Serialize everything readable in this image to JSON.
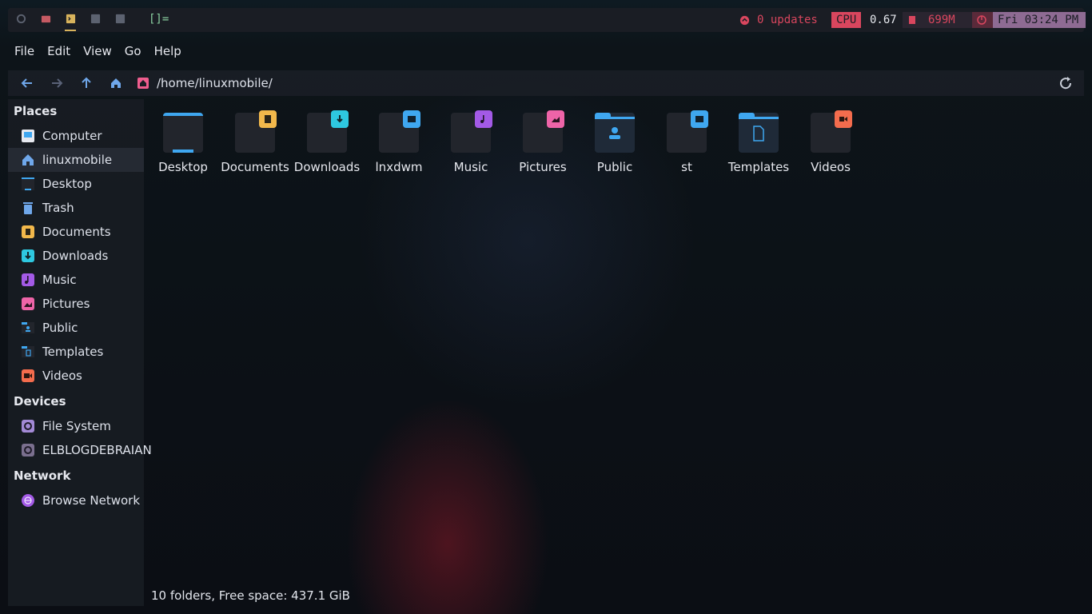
{
  "topbar": {
    "layout": "[]=",
    "updates": "0 updates",
    "cpu_label": "CPU",
    "cpu_value": "0.67",
    "mem_value": "699M",
    "clock": "Fri 03:24 PM"
  },
  "menu": [
    "File",
    "Edit",
    "View",
    "Go",
    "Help"
  ],
  "address": "/home/linuxmobile/",
  "sidebar": {
    "places_title": "Places",
    "places": [
      "Computer",
      "linuxmobile",
      "Desktop",
      "Trash",
      "Documents",
      "Downloads",
      "Music",
      "Pictures",
      "Public",
      "Templates",
      "Videos"
    ],
    "devices_title": "Devices",
    "devices": [
      "File System",
      "ELBLOGDEBRAIAN"
    ],
    "network_title": "Network",
    "network": [
      "Browse Network"
    ]
  },
  "folders": [
    "Desktop",
    "Documents",
    "Downloads",
    "lnxdwm",
    "Music",
    "Pictures",
    "Public",
    "st",
    "Templates",
    "Videos"
  ],
  "status": "10 folders, Free space: 437.1 GiB",
  "colors": {
    "blue": "#3fa7f0",
    "yellow": "#f2b84b",
    "cyan": "#2ec8e0",
    "purple": "#a35ae6",
    "pink": "#ee64a8",
    "orange": "#f46c4d",
    "home": "#ef5d8e",
    "nav": "#6fa7ea"
  }
}
